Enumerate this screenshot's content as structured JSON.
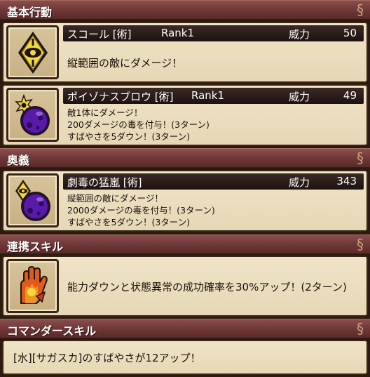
{
  "sections": {
    "basic": {
      "header": "基本行動",
      "skills": [
        {
          "name": "スコール [術]",
          "rank": "Rank1",
          "power_label": "威力",
          "power": "50",
          "icon": "yellow-eye-diamond-icon",
          "desc": [
            "縦範囲の敵にダメージ！"
          ]
        },
        {
          "name": "ポイゾナスブロウ [術]",
          "rank": "Rank1",
          "power_label": "威力",
          "power": "49",
          "icon": "poison-orb-burst-icon",
          "desc": [
            "敵1体にダメージ！",
            "200ダメージの毒を付与！(3ターン)",
            "すばやさを5ダウン！(3ターン)"
          ]
        }
      ]
    },
    "ougi": {
      "header": "奥義",
      "skills": [
        {
          "name": "劇毒の猛嵐 [術]",
          "power_label": "威力",
          "power": "343",
          "icon": "poison-orb-eye-icon",
          "desc": [
            "縦範囲の敵にダメージ！",
            "2000ダメージの毒を付与！(3ターン)",
            "すばやさを5ダウン！(3ターン)"
          ]
        }
      ]
    },
    "link": {
      "header": "連携スキル",
      "icon": "flame-hand-icon",
      "desc": "能力ダウンと状態異常の成功確率を30%アップ！(2ターン)"
    },
    "commander": {
      "header": "コマンダースキル",
      "desc": "[水][サガスカ]のすばやさが12アップ！"
    }
  },
  "colors": {
    "header_bg": "#6e3636",
    "card_bg": "#e9dcbc",
    "title_bar": "#2a1c18",
    "border": "#3c2416"
  }
}
